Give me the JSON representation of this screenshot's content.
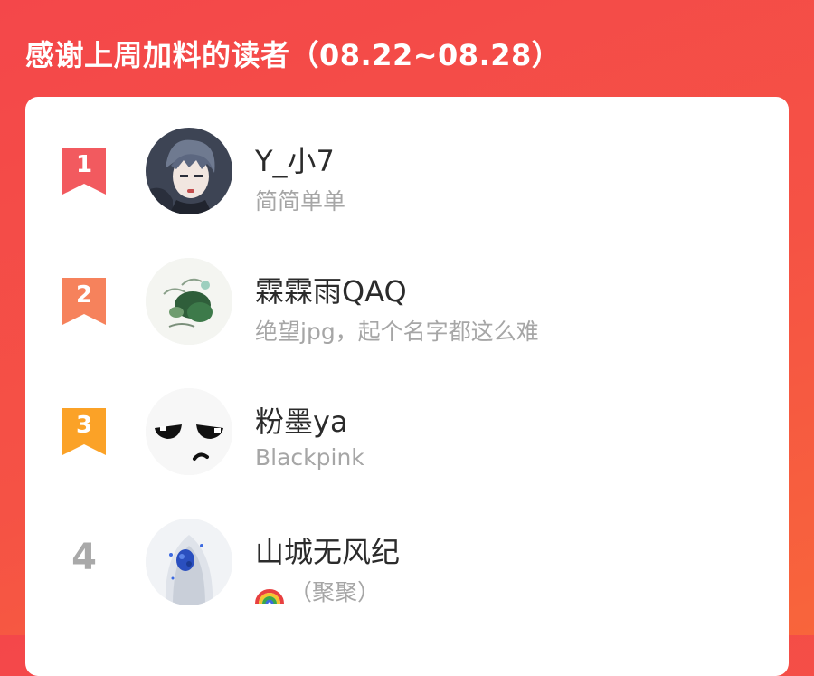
{
  "header": {
    "title": "感谢上周加料的读者（08.22~08.28）"
  },
  "colors": {
    "rank1": "#f25a5f",
    "rank2": "#f6825c",
    "rank3": "#fba227",
    "rank_other": "#a9a9a9"
  },
  "readers": [
    {
      "rank": "1",
      "name": "Y_小7",
      "subtitle": "简简单单",
      "avatar_icon": "anime-boy-avatar-icon"
    },
    {
      "rank": "2",
      "name": "霖霖雨QAQ",
      "subtitle": "绝望jpg，起个名字都这么难",
      "avatar_icon": "lotus-leaf-avatar-icon"
    },
    {
      "rank": "3",
      "name": "粉墨ya",
      "subtitle": "Blackpink",
      "avatar_icon": "annoyed-face-avatar-icon"
    },
    {
      "rank": "4",
      "name": "山城无风纪",
      "subtitle": "（聚聚）",
      "subtitle_icon": "rainbow-icon",
      "avatar_icon": "hooded-figure-avatar-icon"
    }
  ]
}
